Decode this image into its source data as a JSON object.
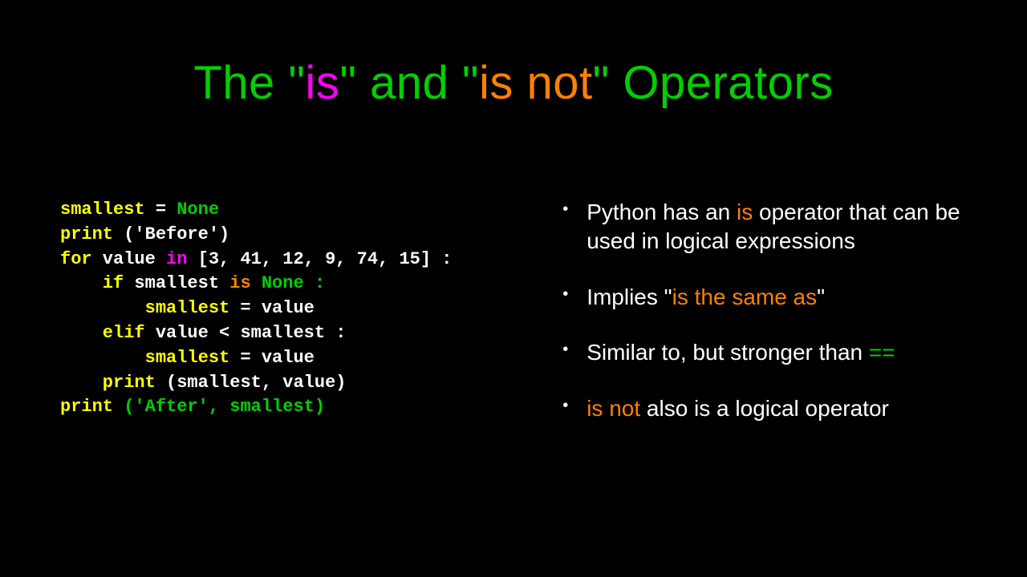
{
  "title": {
    "p1": "The \"",
    "is": "is",
    "p2": "\" and \"",
    "isnot": "is not",
    "p3": "\" Operators"
  },
  "code": {
    "l1_a": "smallest",
    "l1_b": " = ",
    "l1_c": "None",
    "l2_a": "print",
    "l2_b": " ('Before')",
    "l3_a": "for",
    "l3_b": " value ",
    "l3_c": "in",
    "l3_d": " [3, 41, 12, 9, 74, 15] :",
    "l4_a": "    if",
    "l4_b": " smallest ",
    "l4_c": "is",
    "l4_d": " None :",
    "l5_a": "        smallest",
    "l5_b": " = value",
    "l6_a": "    elif",
    "l6_b": " value < smallest :",
    "l7_a": "        smallest",
    "l7_b": " = value",
    "l8_a": "    print",
    "l8_b": " (smallest, value)",
    "l9_a": "print",
    "l9_b": " ('After', smallest)"
  },
  "bullets": {
    "b1_a": "Python has an ",
    "b1_is": "is",
    "b1_b": " operator that can be used in logical expressions",
    "b2_a": "Implies \"",
    "b2_same": "is the same as",
    "b2_b": "\"",
    "b3_a": "Similar to, but stronger than ",
    "b3_eq": "==",
    "b4_isnot": "is not",
    "b4_b": "  also is a logical operator"
  }
}
